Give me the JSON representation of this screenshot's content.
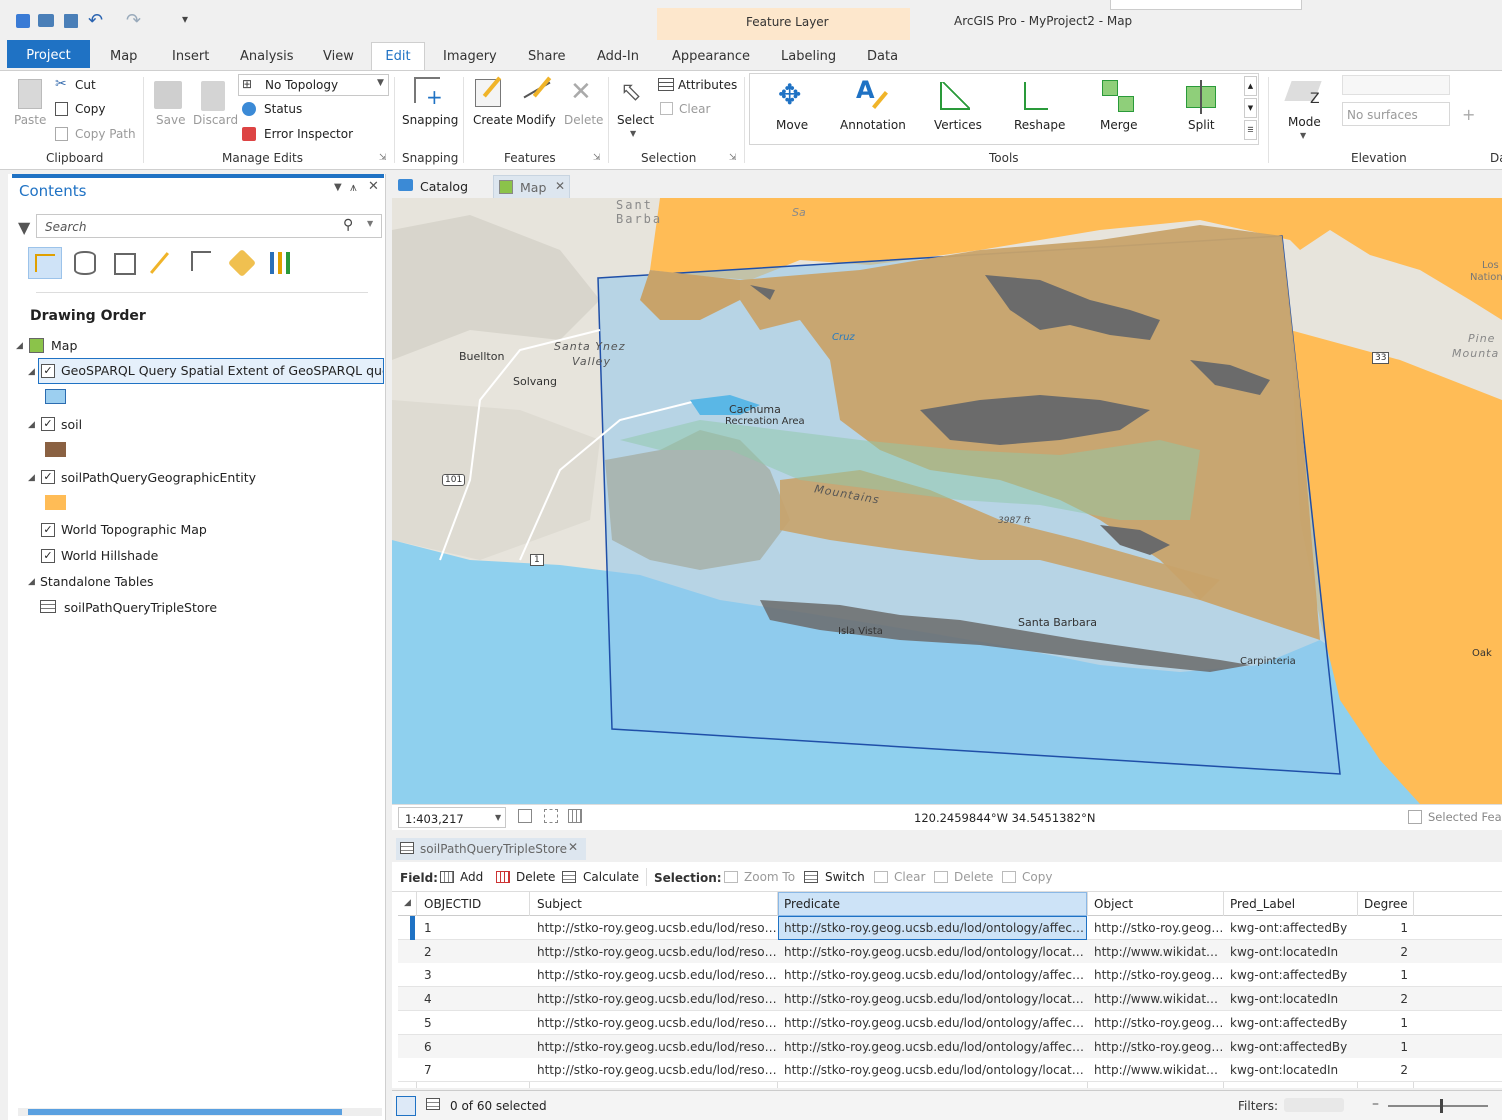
{
  "qat": {
    "feature_layer": "Feature Layer",
    "title": "ArcGIS Pro - MyProject2 - Map"
  },
  "tabs": [
    "Project",
    "Map",
    "Insert",
    "Analysis",
    "View",
    "Edit",
    "Imagery",
    "Share",
    "Add-In",
    "Appearance",
    "Labeling",
    "Data"
  ],
  "ribbon": {
    "clipboard": {
      "paste": "Paste",
      "cut": "Cut",
      "copy": "Copy",
      "copy_path": "Copy Path",
      "label": "Clipboard"
    },
    "manage": {
      "save": "Save",
      "discard": "Discard",
      "topology": "No Topology",
      "status": "Status",
      "error_inspector": "Error Inspector",
      "label": "Manage Edits"
    },
    "snapping": {
      "btn": "Snapping",
      "label": "Snapping"
    },
    "features": {
      "create": "Create",
      "modify": "Modify",
      "delete": "Delete",
      "label": "Features"
    },
    "selection": {
      "select": "Select",
      "attributes": "Attributes",
      "clear": "Clear",
      "label": "Selection"
    },
    "tools": {
      "move": "Move",
      "annotation": "Annotation",
      "vertices": "Vertices",
      "reshape": "Reshape",
      "merge": "Merge",
      "split": "Split",
      "label": "Tools"
    },
    "elevation": {
      "mode": "Mode",
      "surface": "No surfaces",
      "label": "Elevation"
    },
    "da": "Da"
  },
  "contents": {
    "title": "Contents",
    "search_placeholder": "Search",
    "drawing_order": "Drawing Order",
    "layers": {
      "map": "Map",
      "geosparql": "GeoSPARQL Query Spatial Extent of GeoSPARQL query Pc",
      "soil": "soil",
      "soilpath": "soilPathQueryGeographicEntity",
      "topo": "World Topographic Map",
      "hillshade": "World Hillshade",
      "standalone": "Standalone Tables",
      "triplestore": "soilPathQueryTripleStore"
    }
  },
  "view_tabs": {
    "catalog": "Catalog",
    "map": "Map"
  },
  "map": {
    "scale": "1:403,217",
    "coords": "120.2459844°W 34.5451382°N",
    "selected": "Selected Feat",
    "labels": {
      "santa_barbara_top": "Sant\nBarba",
      "buellton": "Buellton",
      "solvang": "Solvang",
      "santa_ynez": "Santa Ynez",
      "valley": "Valley",
      "cachuma": "Cachuma",
      "recreation": "Recreation Area",
      "mountains": "Mountains",
      "elev": "3987 ft",
      "santa_barbara": "Santa Barbara",
      "isla_vista": "Isla Vista",
      "carpinteria": "Carpinteria",
      "los": "Los",
      "nation": "Nation",
      "pine": "Pine",
      "mounta": "Mounta",
      "oak": "Oak",
      "hwy101": "101",
      "hwy1": "1",
      "hwy33": "33",
      "cruz": "Cruz",
      "sa": "Sa"
    }
  },
  "table": {
    "tab": "soilPathQueryTripleStore",
    "field_label": "Field:",
    "add": "Add",
    "delete": "Delete",
    "calculate": "Calculate",
    "selection_label": "Selection:",
    "zoom_to": "Zoom To",
    "switch": "Switch",
    "clear": "Clear",
    "delete2": "Delete",
    "copy": "Copy",
    "columns": [
      "OBJECTID",
      "Subject",
      "Predicate",
      "Object",
      "Pred_Label",
      "Degree"
    ],
    "rows": [
      [
        "1",
        "http://stko-roy.geog.ucsb.edu/lod/resou...",
        "http://stko-roy.geog.ucsb.edu/lod/ontology/affect...",
        "http://stko-roy.geog....",
        "kwg-ont:affectedBy",
        "1"
      ],
      [
        "2",
        "http://stko-roy.geog.ucsb.edu/lod/resou...",
        "http://stko-roy.geog.ucsb.edu/lod/ontology/locate...",
        "http://www.wikidata....",
        "kwg-ont:locatedIn",
        "2"
      ],
      [
        "3",
        "http://stko-roy.geog.ucsb.edu/lod/resou...",
        "http://stko-roy.geog.ucsb.edu/lod/ontology/affect...",
        "http://stko-roy.geog....",
        "kwg-ont:affectedBy",
        "1"
      ],
      [
        "4",
        "http://stko-roy.geog.ucsb.edu/lod/resou...",
        "http://stko-roy.geog.ucsb.edu/lod/ontology/locate...",
        "http://www.wikidata....",
        "kwg-ont:locatedIn",
        "2"
      ],
      [
        "5",
        "http://stko-roy.geog.ucsb.edu/lod/resou...",
        "http://stko-roy.geog.ucsb.edu/lod/ontology/affect...",
        "http://stko-roy.geog....",
        "kwg-ont:affectedBy",
        "1"
      ],
      [
        "6",
        "http://stko-roy.geog.ucsb.edu/lod/resou...",
        "http://stko-roy.geog.ucsb.edu/lod/ontology/affect...",
        "http://stko-roy.geog....",
        "kwg-ont:affectedBy",
        "1"
      ],
      [
        "7",
        "http://stko-roy.geog.ucsb.edu/lod/resou...",
        "http://stko-roy.geog.ucsb.edu/lod/ontology/locate...",
        "http://www.wikidata....",
        "kwg-ont:locatedIn",
        "2"
      ]
    ],
    "status": "0 of 60 selected",
    "filters": "Filters:"
  },
  "colors": {
    "accent": "#1f72c4",
    "orange": "#ffbc56",
    "soil": "#c8a36a",
    "dark": "#6b6b6b",
    "water": "#8fd0ee"
  }
}
